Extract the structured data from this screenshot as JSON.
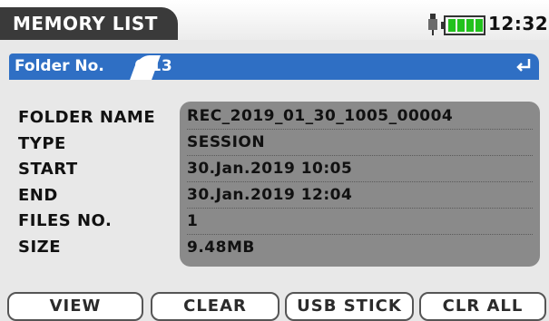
{
  "header": {
    "title": "MEMORY LIST",
    "time": "12:32",
    "icons": [
      "probe-icon",
      "battery-icon"
    ],
    "battery_color": "#22c21d"
  },
  "folder": {
    "label": "Folder No.",
    "value": "6/13",
    "bar_color": "#2f6fc4",
    "icon": "enter-icon"
  },
  "details": [
    {
      "label": "FOLDER NAME",
      "value": "REC_2019_01_30_1005_00004"
    },
    {
      "label": "TYPE",
      "value": "SESSION"
    },
    {
      "label": "START",
      "value": "30.Jan.2019 10:05"
    },
    {
      "label": "END",
      "value": "30.Jan.2019 12:04"
    },
    {
      "label": "FILES NO.",
      "value": "1"
    },
    {
      "label": "SIZE",
      "value": "9.48MB"
    }
  ],
  "buttons": [
    "VIEW",
    "CLEAR",
    "USB STICK",
    "CLR ALL"
  ]
}
